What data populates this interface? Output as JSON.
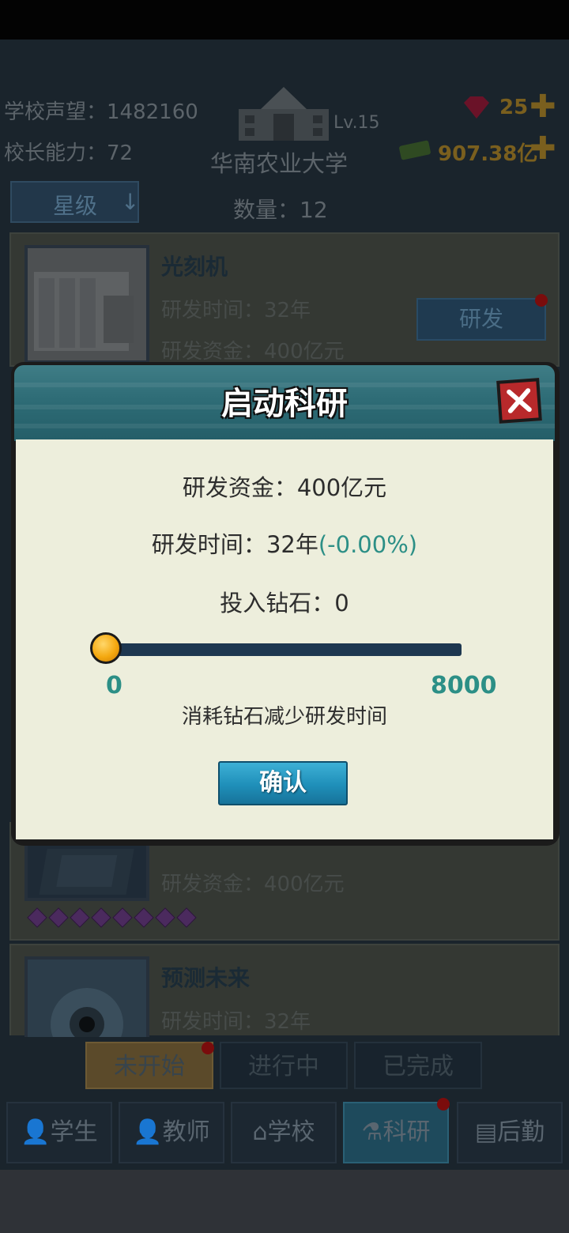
{
  "header": {
    "school_prestige_label": "学校声望：",
    "school_prestige_value": "1482160",
    "principal_ability_label": "校长能力：",
    "principal_ability_value": "72",
    "school_level": "Lv.15",
    "school_name": "华南农业大学",
    "gems": "25",
    "money": "907.38亿"
  },
  "toolbar": {
    "sort_label": "星级",
    "count_label": "数量：",
    "count_value": "12"
  },
  "projects": [
    {
      "name": "光刻机",
      "time": "研发时间：32年",
      "funds": "研发资金：400亿元",
      "action": "研发"
    },
    {
      "funds": "研发资金：400亿元",
      "stars": 8
    },
    {
      "name": "预测未来",
      "time": "研发时间：32年"
    }
  ],
  "status_tabs": [
    "未开始",
    "进行中",
    "已完成"
  ],
  "bottom_nav": [
    {
      "label": "学生",
      "icon": "student-icon"
    },
    {
      "label": "教师",
      "icon": "teacher-icon"
    },
    {
      "label": "学校",
      "icon": "school-icon"
    },
    {
      "label": "科研",
      "icon": "flask-icon",
      "active": true
    },
    {
      "label": "后勤",
      "icon": "clipboard-icon"
    }
  ],
  "modal": {
    "title": "启动科研",
    "funds_label": "研发资金：",
    "funds_value": "400亿元",
    "time_label": "研发时间：",
    "time_value": "32年",
    "time_reduction": "(-0.00%)",
    "diamond_label": "投入钻石：",
    "diamond_value": "0",
    "slider": {
      "min": "0",
      "max": "8000",
      "value": 0
    },
    "hint": "消耗钻石减少研发时间",
    "confirm_label": "确认"
  },
  "colors": {
    "accent_teal": "#2c8f86",
    "header_teal": "#2e6c76",
    "close_red": "#b8292b",
    "confirm_blue": "#1f8fb9"
  }
}
